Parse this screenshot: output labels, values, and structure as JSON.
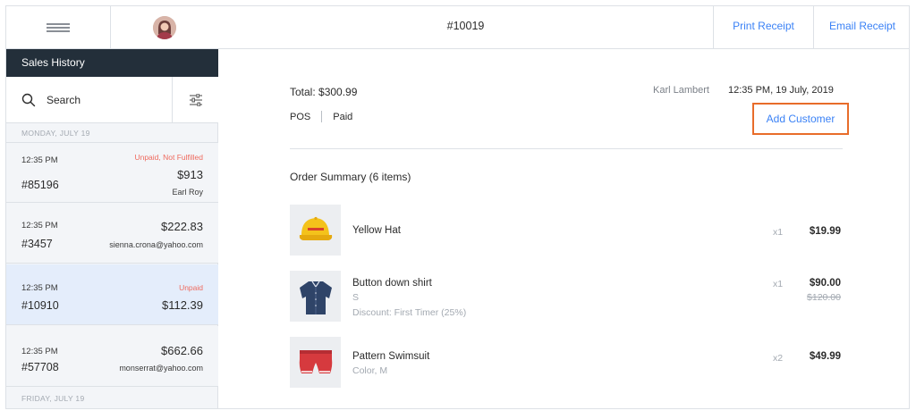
{
  "sidebar": {
    "header": "Sales History",
    "search_label": "Search",
    "day_headers": [
      "MONDAY, JULY 19",
      "FRIDAY, JULY 19"
    ],
    "sales": [
      {
        "time": "12:35 PM",
        "number": "#85196",
        "status": "Unpaid, Not Fulfilled",
        "amount": "$913",
        "sub": "Earl Roy"
      },
      {
        "time": "12:35 PM",
        "number": "#3457",
        "status": "",
        "amount": "$222.83",
        "sub": "sienna.crona@yahoo.com"
      },
      {
        "time": "12:35 PM",
        "number": "#10910",
        "status": "Unpaid",
        "amount": "$112.39",
        "sub": ""
      },
      {
        "time": "12:35 PM",
        "number": "#57708",
        "status": "",
        "amount": "$662.66",
        "sub": "monserrat@yahoo.com"
      }
    ]
  },
  "header": {
    "order_id": "#10019",
    "print_receipt": "Print Receipt",
    "email_receipt": "Email Receipt"
  },
  "order": {
    "total": "Total: $300.99",
    "channel": "POS",
    "payment_status": "Paid",
    "staff": "Karl Lambert",
    "datetime": "12:35 PM, 19 July, 2019",
    "add_customer": "Add Customer",
    "summary_title": "Order Summary (6 items)",
    "items": [
      {
        "name": "Yellow Hat",
        "variant": "",
        "discount": "",
        "qty": "x1",
        "price": "$19.99",
        "original_price": ""
      },
      {
        "name": "Button down shirt",
        "variant": "S",
        "discount": "Discount: First Timer (25%)",
        "qty": "x1",
        "price": "$90.00",
        "original_price": "$120.00"
      },
      {
        "name": "Pattern Swimsuit",
        "variant": "Color, M",
        "discount": "",
        "qty": "x2",
        "price": "$49.99",
        "original_price": ""
      }
    ]
  },
  "colors": {
    "accent_link": "#3b82f6",
    "highlight_border": "#e86c2a",
    "unpaid_status": "#ef6a5e",
    "sidebar_header_bg": "#232f3a",
    "selected_row_bg": "#e4edfb"
  }
}
